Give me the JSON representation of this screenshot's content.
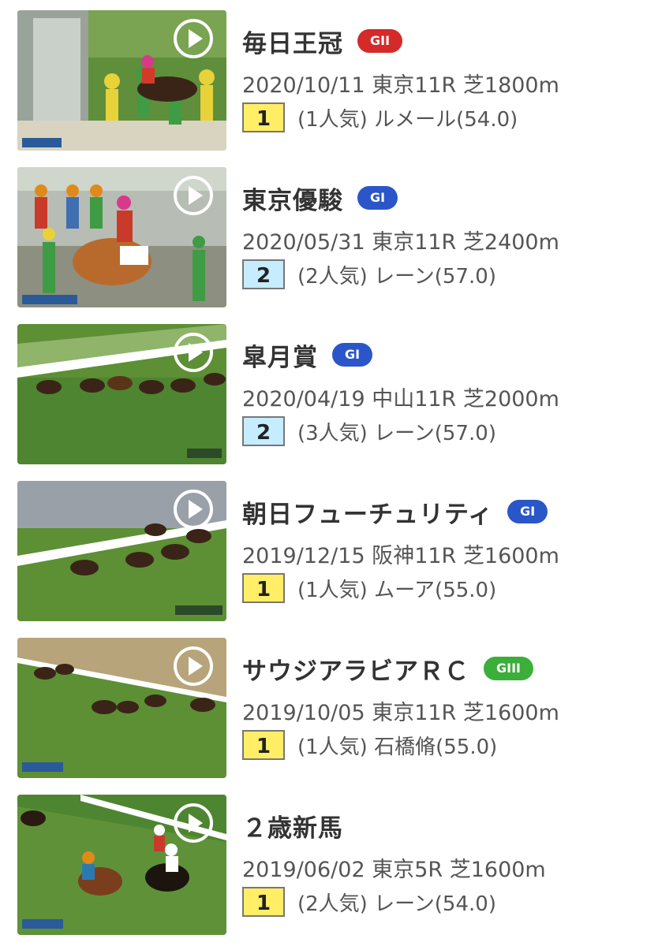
{
  "colors": {
    "badge_gii": "#d42a2a",
    "badge_gi": "#2a56c9",
    "badge_giii": "#3cae3a",
    "pos_first": "#ffee66",
    "pos_second": "#c6ecff"
  },
  "races": [
    {
      "title": "毎日王冠",
      "grade": "GII",
      "grade_color": "#d42a2a",
      "meta": "2020/10/11 東京11R 芝1800m",
      "position": "1",
      "result": "(1人気) ルメール(54.0)"
    },
    {
      "title": "東京優駿",
      "grade": "GI",
      "grade_color": "#2a56c9",
      "meta": "2020/05/31 東京11R 芝2400m",
      "position": "2",
      "result": "(2人気) レーン(57.0)"
    },
    {
      "title": "皐月賞",
      "grade": "GI",
      "grade_color": "#2a56c9",
      "meta": "2020/04/19 中山11R 芝2000m",
      "position": "2",
      "result": "(3人気) レーン(57.0)"
    },
    {
      "title": "朝日フューチュリティ",
      "grade": "GI",
      "grade_color": "#2a56c9",
      "meta": "2019/12/15 阪神11R 芝1600m",
      "position": "1",
      "result": "(1人気) ムーア(55.0)"
    },
    {
      "title": "サウジアラビアＲＣ",
      "grade": "GIII",
      "grade_color": "#3cae3a",
      "meta": "2019/10/05 東京11R 芝1600m",
      "position": "1",
      "result": "(1人気) 石橋脩(55.0)"
    },
    {
      "title": "２歳新馬",
      "grade": "",
      "grade_color": "",
      "meta": "2019/06/02 東京5R 芝1600m",
      "position": "1",
      "result": "(2人気) レーン(54.0)"
    }
  ]
}
